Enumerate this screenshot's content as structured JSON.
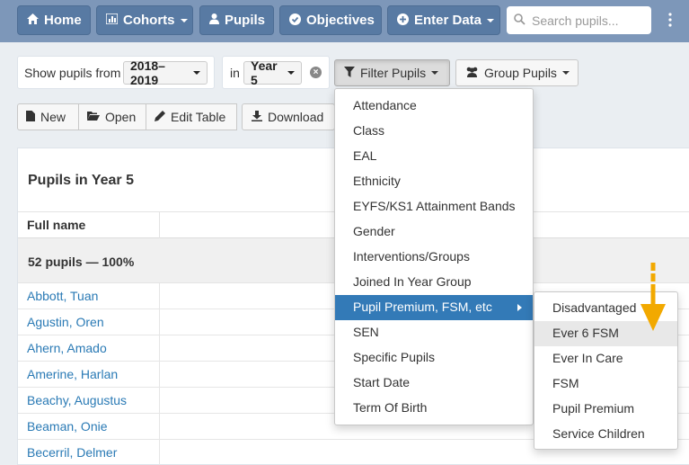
{
  "navbar": {
    "home": "Home",
    "cohorts": "Cohorts",
    "pupils": "Pupils",
    "objectives": "Objectives",
    "enter_data": "Enter Data",
    "search_placeholder": "Search pupils..."
  },
  "filters": {
    "show_label": "Show pupils from",
    "year_range": "2018–2019",
    "in_label": "in",
    "year_group": "Year 5",
    "filter_pupils": "Filter Pupils",
    "group_pupils": "Group Pupils"
  },
  "toolbar": {
    "new": "New",
    "open": "Open",
    "edit_table": "Edit Table",
    "download": "Download"
  },
  "table": {
    "title": "Pupils in Year 5",
    "col_full_name": "Full name",
    "summary": "52 pupils — 100%",
    "pupils": [
      "Abbott, Tuan",
      "Agustin, Oren",
      "Ahern, Amado",
      "Amerine, Harlan",
      "Beachy, Augustus",
      "Beaman, Onie",
      "Becerril, Delmer"
    ]
  },
  "filter_menu": {
    "items": [
      "Attendance",
      "Class",
      "EAL",
      "Ethnicity",
      "EYFS/KS1 Attainment Bands",
      "Gender",
      "Interventions/Groups",
      "Joined In Year Group",
      "Pupil Premium, FSM, etc",
      "SEN",
      "Specific Pupils",
      "Start Date",
      "Term Of Birth"
    ],
    "active_index": 8
  },
  "submenu": {
    "items": [
      "Disadvantaged",
      "Ever 6 FSM",
      "Ever In Care",
      "FSM",
      "Pupil Premium",
      "Service Children"
    ],
    "hover_index": 1
  },
  "colors": {
    "navbar_bg": "#7d97b9",
    "nav_button": "#587aa3",
    "active_menu": "#337ab7",
    "link": "#2a7ab5",
    "arrow": "#f2a900"
  }
}
